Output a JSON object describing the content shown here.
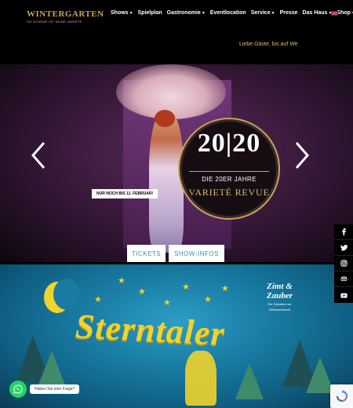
{
  "header": {
    "logo": {
      "name": "WINTERGARTEN",
      "tagline": "SO SCHÖNE IST KEINE VARIETÉ"
    },
    "nav": [
      {
        "label": "Shows",
        "dropdown": true
      },
      {
        "label": "Spielplan",
        "dropdown": false
      },
      {
        "label": "Gastronomie",
        "dropdown": true
      },
      {
        "label": "Eventlocation",
        "dropdown": false
      },
      {
        "label": "Service",
        "dropdown": true
      },
      {
        "label": "Presse",
        "dropdown": false
      },
      {
        "label": "Das Haus",
        "dropdown": true
      },
      {
        "label": "Shop",
        "dropdown": true
      }
    ],
    "ticker": "Liebe Gäste, bis auf We"
  },
  "hero": {
    "badge": {
      "number": "20|20",
      "subtitle": "DIE 20ER JAHRE",
      "title": "VARIETÉ REVUE"
    },
    "notice": {
      "text": "NUR NOCH BIS",
      "highlight": "11. FEBRUAR!"
    },
    "buttons": {
      "tickets": "TICKETS",
      "info": "SHOW-INFOS"
    }
  },
  "promo": {
    "title": "Sterntaler",
    "side_title_1": "Zimt &",
    "side_title_2": "Zauber",
    "side_sub_1": "Der Klassiker zur",
    "side_sub_2": "Weihnachtszeit"
  },
  "social": [
    "facebook-icon",
    "twitter-icon",
    "instagram-icon",
    "tripadvisor-icon",
    "youtube-icon"
  ],
  "chat": {
    "prompt": "Haben Sie eine Frage?"
  },
  "colors": {
    "gold": "#c9a45a",
    "link_blue": "#2c94c4",
    "whatsapp": "#25d366",
    "star_yellow": "#f0d32c"
  }
}
